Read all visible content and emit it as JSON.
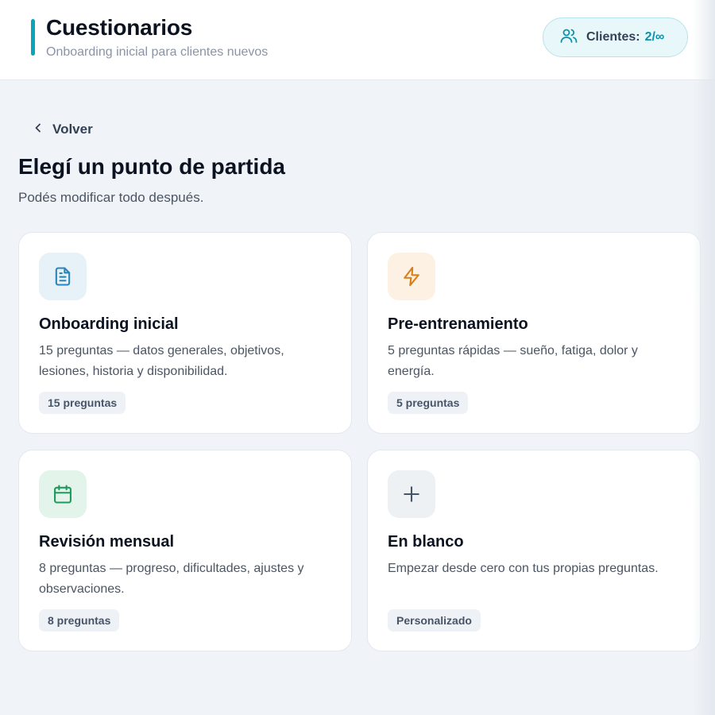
{
  "header": {
    "title": "Cuestionarios",
    "subtitle": "Onboarding inicial para clientes nuevos",
    "clients_label": "Clientes:",
    "clients_value": "2/∞",
    "clients_icon": "users-icon"
  },
  "back": {
    "label": "Volver",
    "icon": "chevron-left-icon"
  },
  "main": {
    "title": "Elegí un punto de partida",
    "subtitle": "Podés modificar todo después."
  },
  "cards": [
    {
      "title": "Onboarding inicial",
      "description": "15 preguntas — datos generales, objetivos, lesiones, historia y disponibilidad.",
      "badge": "15 preguntas",
      "icon": "document-icon",
      "icon_color": "#2a86b8",
      "icon_bg": "#e6f1f8"
    },
    {
      "title": "Pre-entrenamiento",
      "description": "5 preguntas rápidas — sueño, fatiga, dolor y energía.",
      "badge": "5 preguntas",
      "icon": "lightning-icon",
      "icon_color": "#d97f1a",
      "icon_bg": "#fdf1e3"
    },
    {
      "title": "Revisión mensual",
      "description": "8 preguntas — progreso, dificultades, ajustes y observaciones.",
      "badge": "8 preguntas",
      "icon": "calendar-icon",
      "icon_color": "#1f9a5c",
      "icon_bg": "#e3f5ea"
    },
    {
      "title": "En blanco",
      "description": "Empezar desde cero con tus propias preguntas.",
      "badge": "Personalizado",
      "icon": "plus-icon",
      "icon_color": "#475569",
      "icon_bg": "#eef1f4"
    }
  ],
  "colors": {
    "accent": "#0aa5b9",
    "background": "#f0f3f7"
  }
}
